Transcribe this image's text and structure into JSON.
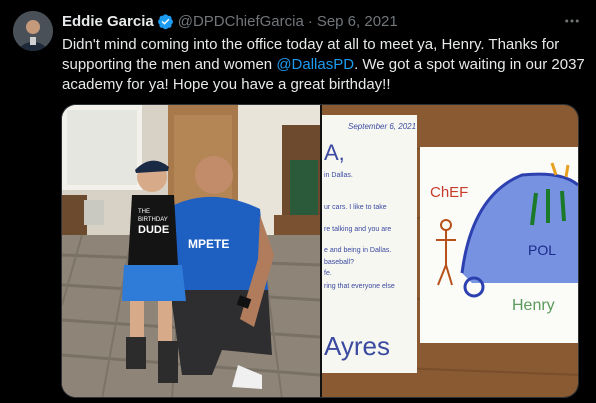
{
  "tweet": {
    "author_name": "Eddie Garcia",
    "handle": "@DPDChiefGarcia",
    "date": "Sep 6, 2021",
    "separator": "·",
    "more_icon": "ellipsis-icon",
    "text_part1": "Didn't mind coming into the office today at all to meet ya, Henry. Thanks for supporting the men and women ",
    "mention": "@DallasPD",
    "text_part2": ". We got a spot waiting in our 2037 academy for ya! Hope you have a great birthday!!"
  },
  "media": {
    "boy_shirt_line1": "THE",
    "boy_shirt_line2": "BIRTHDAY",
    "boy_shirt_line3": "DUDE",
    "chief_shirt": "MPETE",
    "letter_date": "September 6, 2021",
    "letter_greeting": "A,",
    "letter_lines": [
      "in Dallas.",
      "ur cars. I like to take",
      "re talking and you are",
      "e and being in Dallas.",
      "baseball?",
      "fe.",
      "ring that everyone else"
    ],
    "letter_signature": "Ayres",
    "drawing_label_chief": "ChEF",
    "drawing_label_henry": "Henry",
    "drawing_car_text": "POL"
  },
  "colors": {
    "accent": "#1d9bf0",
    "background": "#000000",
    "text": "#e7e9ea",
    "muted": "#71767b"
  }
}
